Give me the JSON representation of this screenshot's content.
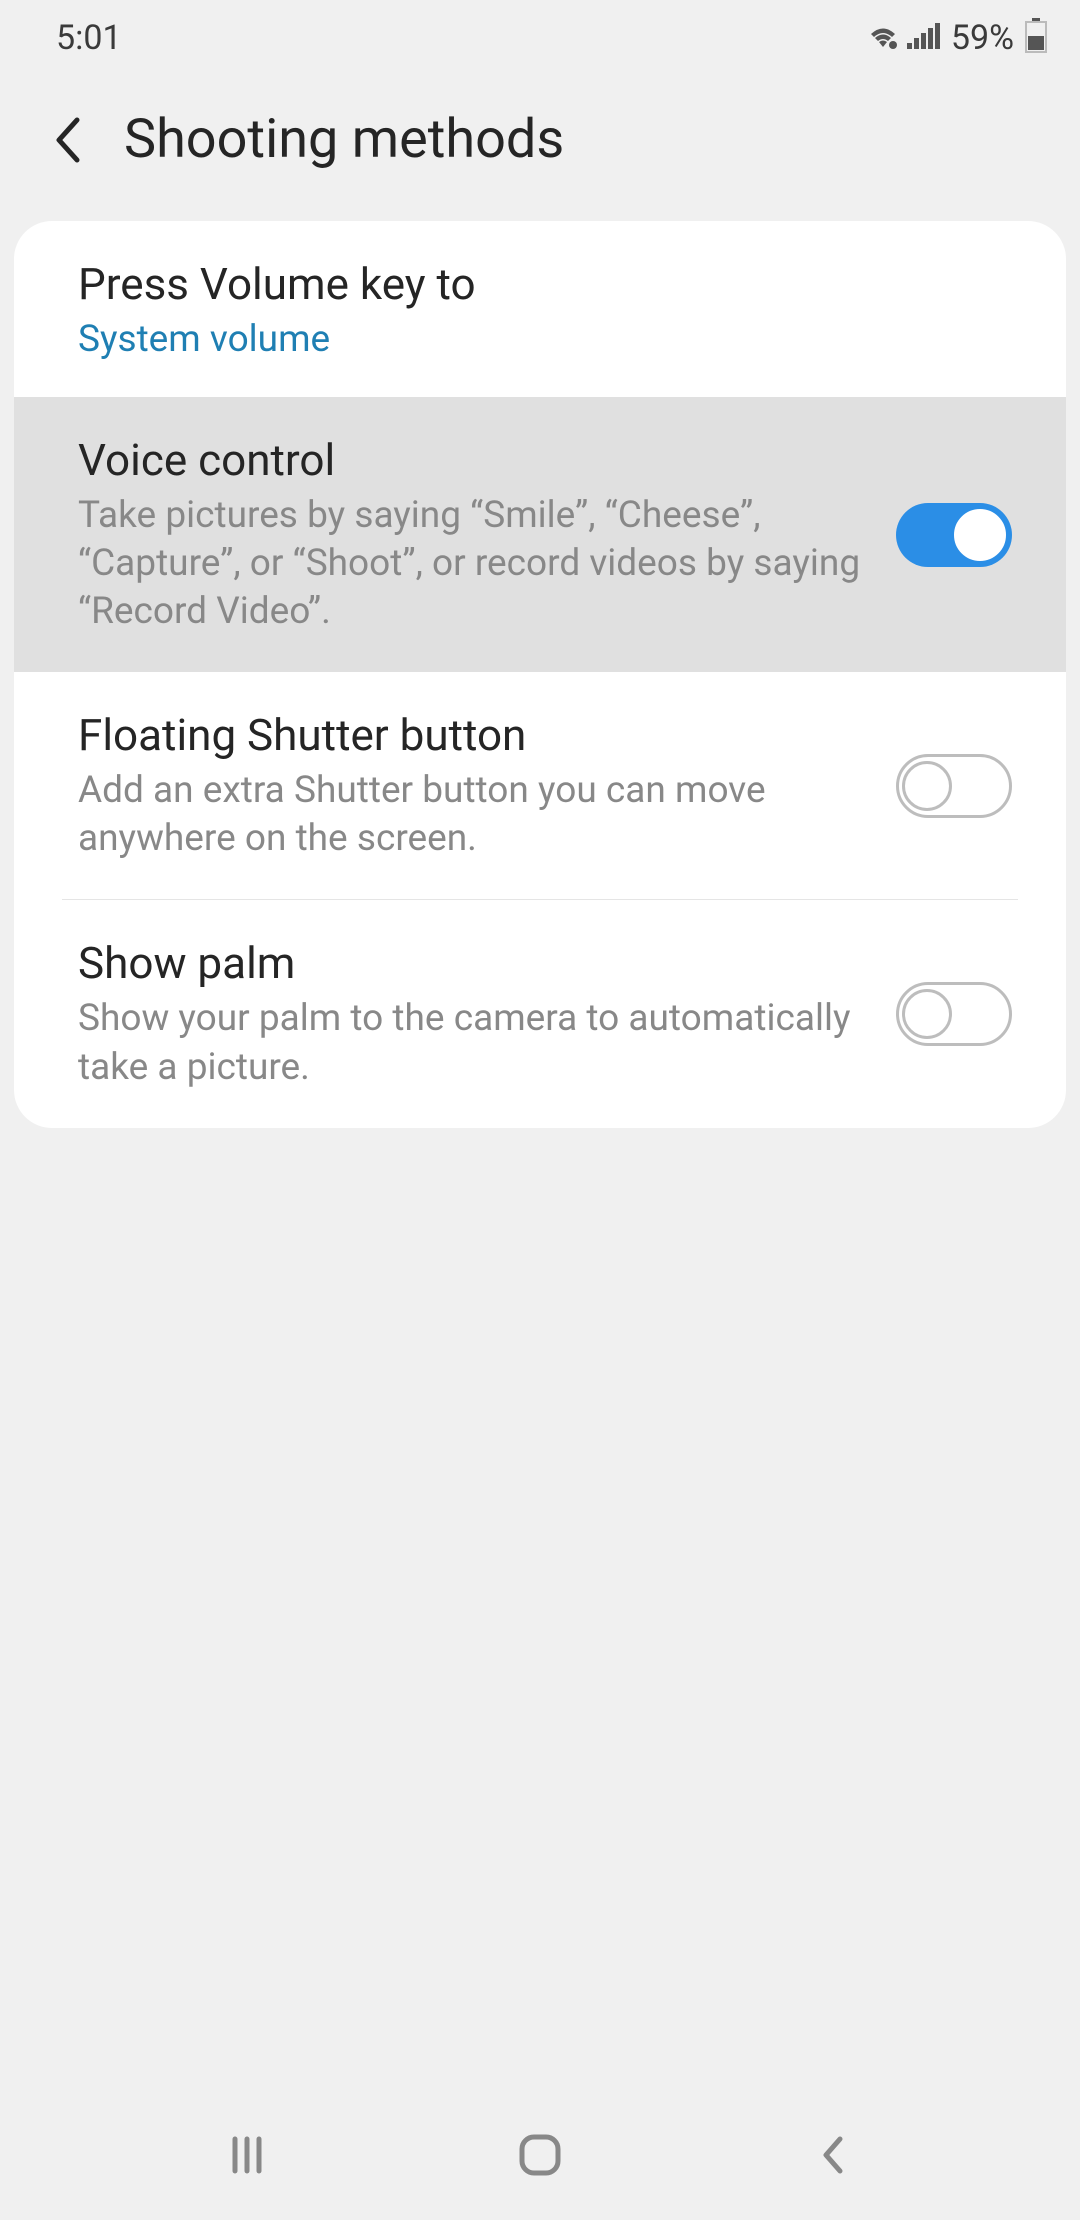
{
  "statusBar": {
    "time": "5:01",
    "batteryPercent": "59%"
  },
  "header": {
    "title": "Shooting methods"
  },
  "settings": {
    "volumeKey": {
      "title": "Press Volume key to",
      "value": "System volume"
    },
    "voiceControl": {
      "title": "Voice control",
      "description": "Take pictures by saying “Smile”, “Cheese”, “Capture”, or “Shoot”, or record videos by saying “Record Video”.",
      "enabled": true
    },
    "floatingShutter": {
      "title": "Floating Shutter button",
      "description": "Add an extra Shutter button you can move anywhere on the screen.",
      "enabled": false
    },
    "showPalm": {
      "title": "Show palm",
      "description": "Show your palm to the camera to automatically take a picture.",
      "enabled": false
    }
  }
}
